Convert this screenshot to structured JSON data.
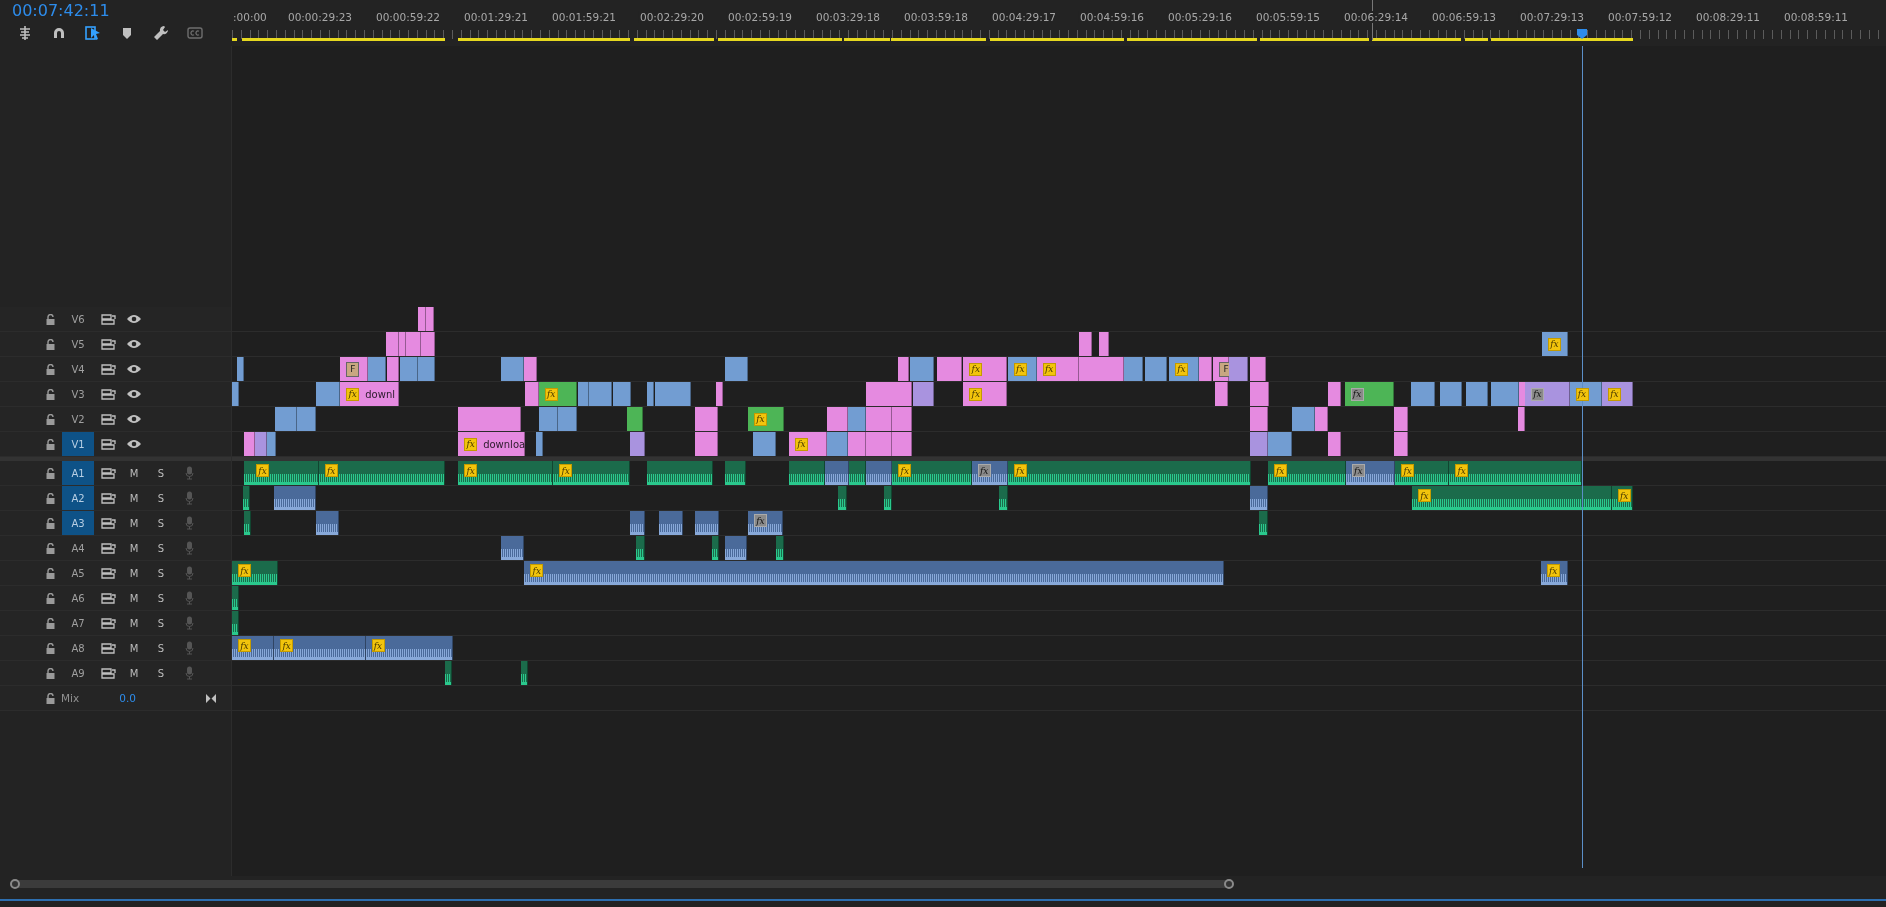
{
  "timecode": "00:07:42:11",
  "tools": [
    {
      "kind": "nest",
      "on": false
    },
    {
      "kind": "snap",
      "on": false
    },
    {
      "kind": "linked",
      "on": true
    },
    {
      "kind": "marker",
      "on": false
    },
    {
      "kind": "settings",
      "on": false
    },
    {
      "kind": "captions",
      "on": false
    }
  ],
  "ruler": {
    "labels": [
      ":00:00",
      "00:00:29:23",
      "00:00:59:22",
      "00:01:29:21",
      "00:01:59:21",
      "00:02:29:20",
      "00:02:59:19",
      "00:03:29:18",
      "00:03:59:18",
      "00:04:29:17",
      "00:04:59:16",
      "00:05:29:16",
      "00:05:59:15",
      "00:06:29:14",
      "00:06:59:13",
      "00:07:29:13",
      "00:07:59:12",
      "00:08:29:11",
      "00:08:59:11"
    ]
  },
  "video_tracks": [
    {
      "name": "V6",
      "targeted": false,
      "clips": [
        {
          "color": "#e58ae0"
        },
        {
          "color": "#e58ae0"
        }
      ]
    },
    {
      "name": "V5",
      "targeted": false,
      "clips": [
        {
          "color": "#e58ae0"
        },
        {
          "color": "#e58ae0"
        },
        {
          "color": "#e58ae0"
        },
        {
          "color": "#e58ae0"
        },
        {
          "color": "#e58ae0"
        },
        {
          "color": "#e58ae0"
        },
        {
          "color": "#729dd2",
          "fx": "fx",
          "fx_on": true
        }
      ]
    },
    {
      "name": "V4",
      "targeted": false,
      "clips": [
        {
          "color": "#729dd2"
        },
        {
          "color": "#e58ae0",
          "badge": "F"
        },
        {
          "color": "#729dd2"
        },
        {
          "color": "#e58ae0"
        },
        {
          "color": "#729dd2"
        },
        {
          "color": "#729dd2"
        },
        {
          "color": "#729dd2"
        },
        {
          "color": "#e58ae0"
        },
        {
          "color": "#729dd2"
        },
        {
          "color": "#e58ae0"
        },
        {
          "color": "#729dd2"
        },
        {
          "color": "#e58ae0"
        },
        {
          "color": "#e58ae0",
          "fx": "fx",
          "fx_on": true
        },
        {
          "color": "#729dd2",
          "fx": "fx",
          "fx_on": true
        },
        {
          "color": "#e58ae0",
          "fx": "fx",
          "fx_on": true
        },
        {
          "color": "#e58ae0"
        },
        {
          "color": "#729dd2"
        },
        {
          "color": "#729dd2"
        },
        {
          "color": "#729dd2",
          "fx": "fx",
          "fx_on": true
        },
        {
          "color": "#e58ae0"
        },
        {
          "color": "#e58ae0",
          "badge": "F"
        },
        {
          "color": "#a993df"
        },
        {
          "color": "#e58ae0"
        }
      ]
    },
    {
      "name": "V3",
      "targeted": false,
      "clips": [
        {
          "color": "#729dd2"
        },
        {
          "color": "#729dd2"
        },
        {
          "color": "#e58ae0",
          "fx": "fx",
          "fx_on": true,
          "label": "downl"
        },
        {
          "color": "#e58ae0"
        },
        {
          "color": "#4db556",
          "fx": "fx",
          "fx_on": true
        },
        {
          "color": "#729dd2"
        },
        {
          "color": "#729dd2"
        },
        {
          "color": "#729dd2"
        },
        {
          "color": "#729dd2"
        },
        {
          "color": "#729dd2"
        },
        {
          "color": "#e58ae0"
        },
        {
          "color": "#e58ae0"
        },
        {
          "color": "#a993df"
        },
        {
          "color": "#e58ae0",
          "fx": "fx",
          "fx_on": true
        },
        {
          "color": "#e58ae0"
        },
        {
          "color": "#e58ae0"
        },
        {
          "color": "#e58ae0"
        },
        {
          "color": "#4db556",
          "fx": "fx",
          "fx_on": false
        },
        {
          "color": "#729dd2"
        },
        {
          "color": "#729dd2"
        },
        {
          "color": "#729dd2"
        },
        {
          "color": "#729dd2"
        },
        {
          "color": "#e58ae0"
        },
        {
          "color": "#a993df",
          "fx": "fx",
          "fx_on": false
        },
        {
          "color": "#729dd2",
          "fx": "fx",
          "fx_on": true
        },
        {
          "color": "#a993df",
          "fx": "fx",
          "fx_on": true
        }
      ]
    },
    {
      "name": "V2",
      "targeted": false,
      "clips": [
        {
          "color": "#729dd2"
        },
        {
          "color": "#729dd2"
        },
        {
          "color": "#e58ae0"
        },
        {
          "color": "#729dd2"
        },
        {
          "color": "#729dd2"
        },
        {
          "color": "#4db556"
        },
        {
          "color": "#e58ae0"
        },
        {
          "color": "#4db556",
          "fx": "fx",
          "fx_on": true
        },
        {
          "color": "#e58ae0"
        },
        {
          "color": "#729dd2"
        },
        {
          "color": "#e58ae0"
        },
        {
          "color": "#e58ae0"
        },
        {
          "color": "#e58ae0"
        },
        {
          "color": "#729dd2"
        },
        {
          "color": "#e58ae0"
        },
        {
          "color": "#e58ae0"
        },
        {
          "color": "#e58ae0"
        }
      ]
    },
    {
      "name": "V1",
      "targeted": true,
      "clips": [
        {
          "color": "#e58ae0"
        },
        {
          "color": "#a993df"
        },
        {
          "color": "#729dd2"
        },
        {
          "color": "#e58ae0",
          "fx": "fx",
          "fx_on": true,
          "label": "downloa"
        },
        {
          "color": "#729dd2"
        },
        {
          "color": "#a993df"
        },
        {
          "color": "#e58ae0"
        },
        {
          "color": "#729dd2"
        },
        {
          "color": "#e58ae0",
          "fx": "fx",
          "fx_on": true
        },
        {
          "color": "#729dd2"
        },
        {
          "color": "#e58ae0"
        },
        {
          "color": "#e58ae0"
        },
        {
          "color": "#e58ae0"
        },
        {
          "color": "#a993df"
        },
        {
          "color": "#729dd2"
        },
        {
          "color": "#e58ae0"
        },
        {
          "color": "#e58ae0"
        }
      ]
    }
  ],
  "audio_tracks": [
    {
      "name": "A1",
      "targeted": true,
      "mute": "M",
      "solo": "S",
      "clips": [
        {
          "color": "#1b6b4b"
        },
        {
          "color": "#1b6b4b",
          "fx": "fx",
          "fx_on": true
        },
        {
          "color": "#1b6b4b",
          "fx": "fx",
          "fx_on": true
        },
        {
          "color": "#1b6b4b",
          "fx": "fx",
          "fx_on": true
        },
        {
          "color": "#1b6b4b",
          "fx": "fx",
          "fx_on": true
        },
        {
          "color": "#1b6b4b"
        },
        {
          "color": "#1b6b4b"
        },
        {
          "color": "#1b6b4b"
        },
        {
          "color": "#4a6a9a"
        },
        {
          "color": "#1b6b4b"
        },
        {
          "color": "#4a6a9a"
        },
        {
          "color": "#1b6b4b",
          "fx": "fx",
          "fx_on": true
        },
        {
          "color": "#4a6a9a",
          "fx": "fx",
          "fx_on": false
        },
        {
          "color": "#1b6b4b",
          "fx": "fx",
          "fx_on": true
        },
        {
          "color": "#1b6b4b",
          "fx": "fx",
          "fx_on": true
        },
        {
          "color": "#4a6a9a",
          "fx": "fx",
          "fx_on": false
        },
        {
          "color": "#1b6b4b",
          "fx": "fx",
          "fx_on": true
        },
        {
          "color": "#1b6b4b",
          "fx": "fx",
          "fx_on": true
        }
      ]
    },
    {
      "name": "A2",
      "targeted": true,
      "mute": "M",
      "solo": "S",
      "clips": [
        {
          "color": "#1b6b4b"
        },
        {
          "color": "#4a6a9a"
        },
        {
          "color": "#1b6b4b"
        },
        {
          "color": "#1b6b4b"
        },
        {
          "color": "#1b6b4b"
        },
        {
          "color": "#4a6a9a"
        },
        {
          "color": "#1b6b4b",
          "fx": "fx",
          "fx_on": true
        },
        {
          "color": "#1b6b4b",
          "fx": "fx",
          "fx_on": true
        }
      ]
    },
    {
      "name": "A3",
      "targeted": true,
      "mute": "M",
      "solo": "S",
      "clips": [
        {
          "color": "#1b6b4b"
        },
        {
          "color": "#4a6a9a"
        },
        {
          "color": "#4a6a9a"
        },
        {
          "color": "#4a6a9a"
        },
        {
          "color": "#4a6a9a"
        },
        {
          "color": "#4a6a9a",
          "fx": "fx",
          "fx_on": false
        },
        {
          "color": "#1b6b4b"
        }
      ]
    },
    {
      "name": "A4",
      "targeted": false,
      "mute": "M",
      "solo": "S",
      "clips": [
        {
          "color": "#4a6a9a"
        },
        {
          "color": "#1b6b4b"
        },
        {
          "color": "#1b6b4b"
        },
        {
          "color": "#4a6a9a"
        },
        {
          "color": "#1b6b4b"
        }
      ]
    },
    {
      "name": "A5",
      "targeted": false,
      "mute": "M",
      "solo": "S",
      "clips": [
        {
          "color": "#1b6b4b",
          "fx": "fx",
          "fx_on": true
        },
        {
          "color": "#4a6a9a",
          "fx": "fx",
          "fx_on": true
        },
        {
          "color": "#4a6a9a",
          "fx": "fx",
          "fx_on": true
        }
      ]
    },
    {
      "name": "A6",
      "targeted": false,
      "mute": "M",
      "solo": "S",
      "clips": [
        {
          "color": "#1b6b4b"
        }
      ]
    },
    {
      "name": "A7",
      "targeted": false,
      "mute": "M",
      "solo": "S",
      "clips": [
        {
          "color": "#1b6b4b"
        }
      ]
    },
    {
      "name": "A8",
      "targeted": false,
      "mute": "M",
      "solo": "S",
      "clips": [
        {
          "color": "#4a6a9a",
          "fx": "fx",
          "fx_on": true
        },
        {
          "color": "#4a6a9a",
          "fx": "fx",
          "fx_on": true
        },
        {
          "color": "#4a6a9a",
          "fx": "fx",
          "fx_on": true
        }
      ]
    },
    {
      "name": "A9",
      "targeted": false,
      "mute": "M",
      "solo": "S",
      "clips": [
        {
          "color": "#1b6b4b"
        },
        {
          "color": "#1b6b4b"
        }
      ]
    }
  ],
  "mix": {
    "label": "Mix",
    "value": "0.0"
  }
}
